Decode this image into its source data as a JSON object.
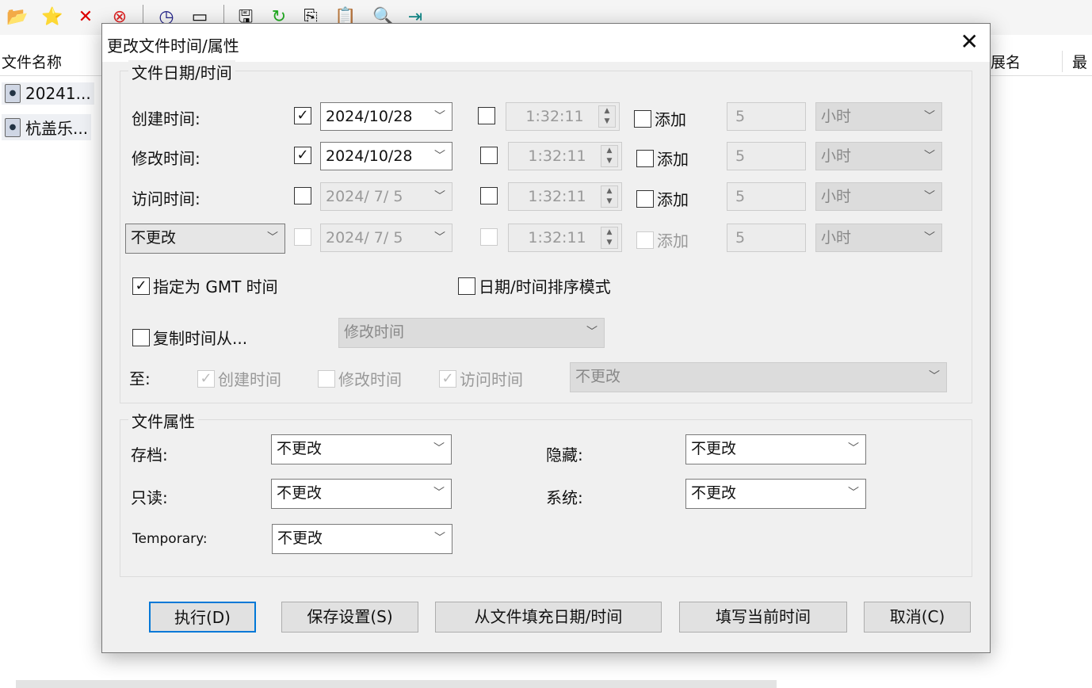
{
  "toolbar": {
    "icons": [
      "open-folder-icon",
      "favorite-folder-icon",
      "delete-icon",
      "stop-icon",
      "clock-icon",
      "window-icon",
      "save-icon",
      "refresh-icon",
      "copy-icon",
      "paste-icon",
      "find-icon",
      "exit-icon"
    ]
  },
  "list": {
    "headers": {
      "name": "文件名称",
      "ext": "展名",
      "last": "最"
    },
    "files": [
      "20241...",
      "杭盖乐..."
    ]
  },
  "dialog": {
    "title": "更改文件时间/属性",
    "date_group": "文件日期/时间",
    "rows": [
      {
        "label": "创建时间:",
        "checked": true,
        "date": "2024/10/28",
        "time": "1:32:11",
        "add": "添加",
        "num": "5",
        "unit": "小时"
      },
      {
        "label": "修改时间:",
        "checked": true,
        "date": "2024/10/28",
        "time": "1:32:11",
        "add": "添加",
        "num": "5",
        "unit": "小时"
      },
      {
        "label": "访问时间:",
        "checked": false,
        "date": "2024/ 7/ 5",
        "time": "1:32:11",
        "add": "添加",
        "num": "5",
        "unit": "小时"
      },
      {
        "label": "不更改",
        "checked": false,
        "date": "2024/ 7/ 5",
        "time": "1:32:11",
        "add": "添加",
        "num": "5",
        "unit": "小时"
      }
    ],
    "gmt": "指定为 GMT 时间",
    "sort_mode": "日期/时间排序模式",
    "copy_from": "复制时间从...",
    "copy_source": "修改时间",
    "to": "至:",
    "to_create": "创建时间",
    "to_modify": "修改时间",
    "to_access": "访问时间",
    "to_select": "不更改",
    "attr_group": "文件属性",
    "attrs": {
      "archive": "存档:",
      "readonly": "只读:",
      "temporary": "Temporary:",
      "hidden": "隐藏:",
      "system": "系统:",
      "value": "不更改"
    },
    "buttons": {
      "execute": "执行(D)",
      "save": "保存设置(S)",
      "fill": "从文件填充日期/时间",
      "now": "填写当前时间",
      "cancel": "取消(C)"
    }
  }
}
